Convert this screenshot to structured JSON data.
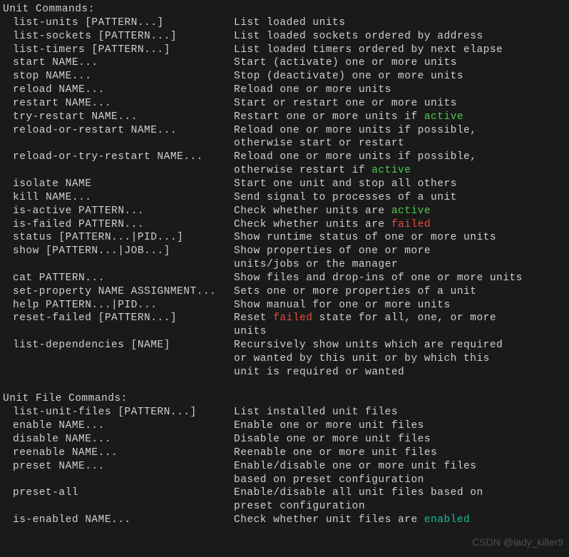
{
  "sections": {
    "unit_commands": {
      "header": "Unit Commands:",
      "items": [
        {
          "cmd": "list-units [PATTERN...]",
          "desc": "List loaded units"
        },
        {
          "cmd": "list-sockets [PATTERN...]",
          "desc": "List loaded sockets ordered by address"
        },
        {
          "cmd": "list-timers [PATTERN...]",
          "desc": "List loaded timers ordered by next elapse"
        },
        {
          "cmd": "start NAME...",
          "desc": "Start (activate) one or more units"
        },
        {
          "cmd": "stop NAME...",
          "desc": "Stop (deactivate) one or more units"
        },
        {
          "cmd": "reload NAME...",
          "desc": "Reload one or more units"
        },
        {
          "cmd": "restart NAME...",
          "desc": "Start or restart one or more units"
        },
        {
          "cmd": "try-restart NAME...",
          "desc_pre": "Restart one or more units if ",
          "hl": "active",
          "hl_class": "green"
        },
        {
          "cmd": "reload-or-restart NAME...",
          "desc": "Reload one or more units if possible,",
          "cont": "otherwise start or restart"
        },
        {
          "cmd": "reload-or-try-restart NAME...",
          "desc": "Reload one or more units if possible,",
          "cont_pre": "otherwise restart if ",
          "cont_hl": "active",
          "cont_hl_class": "green"
        },
        {
          "cmd": "isolate NAME",
          "desc": "Start one unit and stop all others"
        },
        {
          "cmd": "kill NAME...",
          "desc": "Send signal to processes of a unit"
        },
        {
          "cmd": "is-active PATTERN...",
          "desc_pre": "Check whether units are ",
          "hl": "active",
          "hl_class": "green"
        },
        {
          "cmd": "is-failed PATTERN...",
          "desc_pre": "Check whether units are ",
          "hl": "failed",
          "hl_class": "red"
        },
        {
          "cmd": "status [PATTERN...|PID...]",
          "desc": "Show runtime status of one or more units"
        },
        {
          "cmd": "show [PATTERN...|JOB...]",
          "desc": "Show properties of one or more",
          "cont": "units/jobs or the manager"
        },
        {
          "cmd": "cat PATTERN...",
          "desc": "Show files and drop-ins of one or more units"
        },
        {
          "cmd": "set-property NAME ASSIGNMENT...",
          "desc": "Sets one or more properties of a unit"
        },
        {
          "cmd": "help PATTERN...|PID...",
          "desc": "Show manual for one or more units"
        },
        {
          "cmd": "reset-failed [PATTERN...]",
          "desc_pre": "Reset ",
          "hl": "failed",
          "hl_class": "red",
          "desc_post": " state for all, one, or more",
          "cont": "units"
        },
        {
          "cmd": "list-dependencies [NAME]",
          "desc": "Recursively show units which are required",
          "cont": "or wanted by this unit or by which this",
          "cont2": "unit is required or wanted"
        }
      ]
    },
    "unit_file_commands": {
      "header": "Unit File Commands:",
      "items": [
        {
          "cmd": "list-unit-files [PATTERN...]",
          "desc": "List installed unit files"
        },
        {
          "cmd": "enable NAME...",
          "desc": "Enable one or more unit files"
        },
        {
          "cmd": "disable NAME...",
          "desc": "Disable one or more unit files"
        },
        {
          "cmd": "reenable NAME...",
          "desc": "Reenable one or more unit files"
        },
        {
          "cmd": "preset NAME...",
          "desc": "Enable/disable one or more unit files",
          "cont": "based on preset configuration"
        },
        {
          "cmd": "preset-all",
          "desc": "Enable/disable all unit files based on",
          "cont": "preset configuration"
        },
        {
          "cmd": "is-enabled NAME...",
          "desc_pre": "Check whether unit files are ",
          "hl": "enabled",
          "hl_class": "teal"
        }
      ]
    }
  },
  "watermark": "CSDN @lady_killer9"
}
